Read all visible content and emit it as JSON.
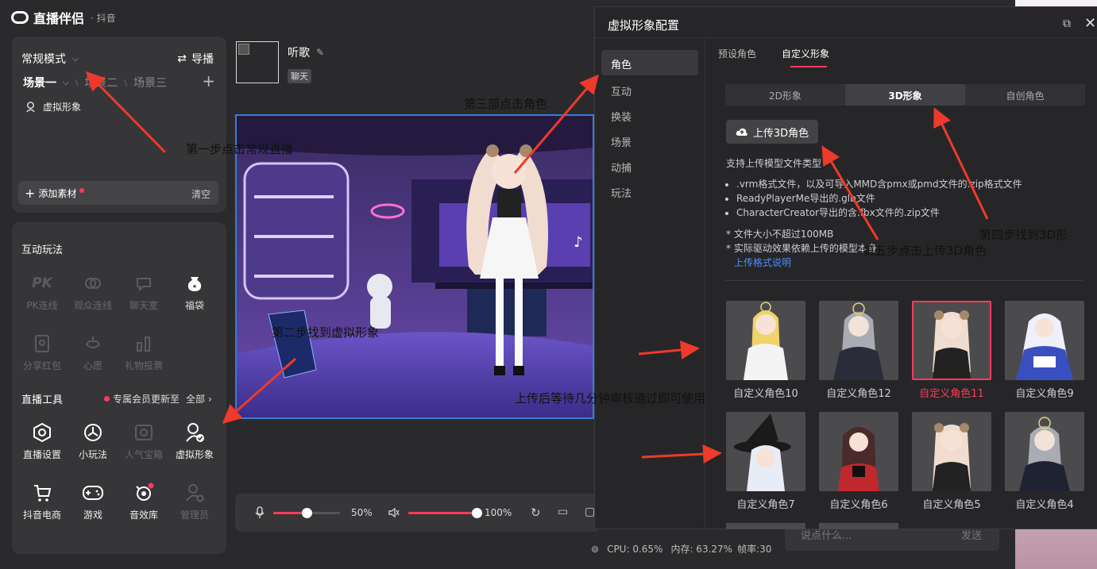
{
  "app": {
    "logo_name": "直播伴侣",
    "platform": "· 抖音"
  },
  "scene_panel": {
    "mode_label": "常规模式",
    "guide_label": "导播",
    "scenes": [
      "场景一",
      "场景二",
      "场景三"
    ],
    "source_item": "虚拟形象",
    "add_material": "添加素材",
    "clear": "清空"
  },
  "interact": {
    "title": "互动玩法",
    "items": [
      {
        "label": "PK连线",
        "icon": "pk-icon",
        "enabled": false
      },
      {
        "label": "观众连线",
        "icon": "link-icon",
        "enabled": false
      },
      {
        "label": "聊天室",
        "icon": "chat-room-icon",
        "enabled": false
      },
      {
        "label": "福袋",
        "icon": "lucky-bag-icon",
        "enabled": true
      },
      {
        "label": "分享红包",
        "icon": "red-packet-icon",
        "enabled": false
      },
      {
        "label": "心愿",
        "icon": "wish-icon",
        "enabled": false
      },
      {
        "label": "礼物投票",
        "icon": "gift-vote-icon",
        "enabled": false
      }
    ]
  },
  "tools": {
    "title": "直播工具",
    "update_notice": "专属会员更新至",
    "all_label": "全部",
    "items": [
      {
        "label": "直播设置",
        "icon": "live-settings-icon"
      },
      {
        "label": "小玩法",
        "icon": "mini-game-icon"
      },
      {
        "label": "人气宝箱",
        "icon": "treasure-box-icon"
      },
      {
        "label": "虚拟形象",
        "icon": "avatar-icon"
      },
      {
        "label": "抖音电商",
        "icon": "cart-icon"
      },
      {
        "label": "游戏",
        "icon": "gamepad-icon"
      },
      {
        "label": "音效库",
        "icon": "sound-library-icon"
      },
      {
        "label": "管理员",
        "icon": "admin-icon"
      }
    ]
  },
  "stream": {
    "title": "听歌",
    "tag": "聊天"
  },
  "controls": {
    "mic_volume": 50,
    "mic_label": "50%",
    "speaker_volume": 100,
    "speaker_label": "100%"
  },
  "status": {
    "cpu": "CPU: 0.65%",
    "mem": "内存: 63.27%",
    "fps": "帧率:30"
  },
  "chat": {
    "placeholder": "说点什么...",
    "send": "发送"
  },
  "dialog": {
    "title": "虚拟形象配置",
    "nav": [
      "角色",
      "互动",
      "换装",
      "场景",
      "动捕",
      "玩法"
    ],
    "active_nav": 0,
    "tabs": [
      "预设角色",
      "自定义形象"
    ],
    "active_tab": 1,
    "segments": [
      "2D形象",
      "3D形象",
      "自创角色"
    ],
    "active_segment": 1,
    "upload_button": "上传3D角色",
    "support_title": "支持上传模型文件类型",
    "formats": [
      ".vrm格式文件，以及可导入MMD含pmx或pmd文件的.zip格式文件",
      "ReadyPlayerMe导出的.glb文件",
      "CharacterCreator导出的含.fbx文件的.zip文件"
    ],
    "note1": "* 文件大小不超过100MB",
    "note2": "* 实际驱动效果依赖上传的模型本身",
    "format_link": "上传格式说明",
    "characters": [
      "自定义角色10",
      "自定义角色12",
      "自定义角色11",
      "自定义角色9",
      "自定义角色7",
      "自定义角色6",
      "自定义角色5",
      "自定义角色4"
    ],
    "selected_character": 2
  },
  "annotations": {
    "step1": "第一步点击常规直播",
    "step2": "第二步找到虚拟形象",
    "step3": "第三部点击角色",
    "step4": "第四步找到3D形",
    "step5": "第五步点击上传3D角色",
    "after_upload": "上传后等待几分钟审核通过即可使用"
  },
  "colors": {
    "accent_red": "#ff3b5c",
    "link_blue": "#4a90ff",
    "preview_border": "#3a7bd5",
    "annotation_arrow": "#ee3a2a"
  }
}
